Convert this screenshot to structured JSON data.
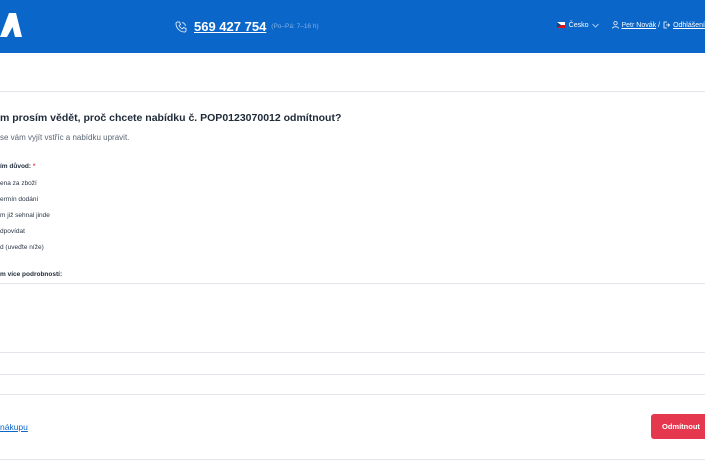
{
  "header": {
    "phone": "569 427 754",
    "hours": "(Po–Pá: 7–16 h)",
    "language": "Česko",
    "user": "Petr Novák",
    "separator": "/",
    "logout": "Odhlášení"
  },
  "colors": {
    "brand": "#0b66c9",
    "danger": "#e5384f"
  },
  "form": {
    "heading": "m prosím vědět, proč chcete nabídku č. POP0123070012 odmítnout?",
    "subtitle": "se vám vyjít vstříc a nabídku upravit.",
    "reason_label": "ím důvod:",
    "required_mark": "*",
    "options": [
      "ena za zboží",
      "ermín dodání",
      "m již sehnal jinde",
      "dpovídat",
      "d (uveďte níže)"
    ],
    "details_label": "m více podrobností:"
  },
  "footer": {
    "back_link": "nákupu",
    "reject_button": "Odmítnout"
  }
}
